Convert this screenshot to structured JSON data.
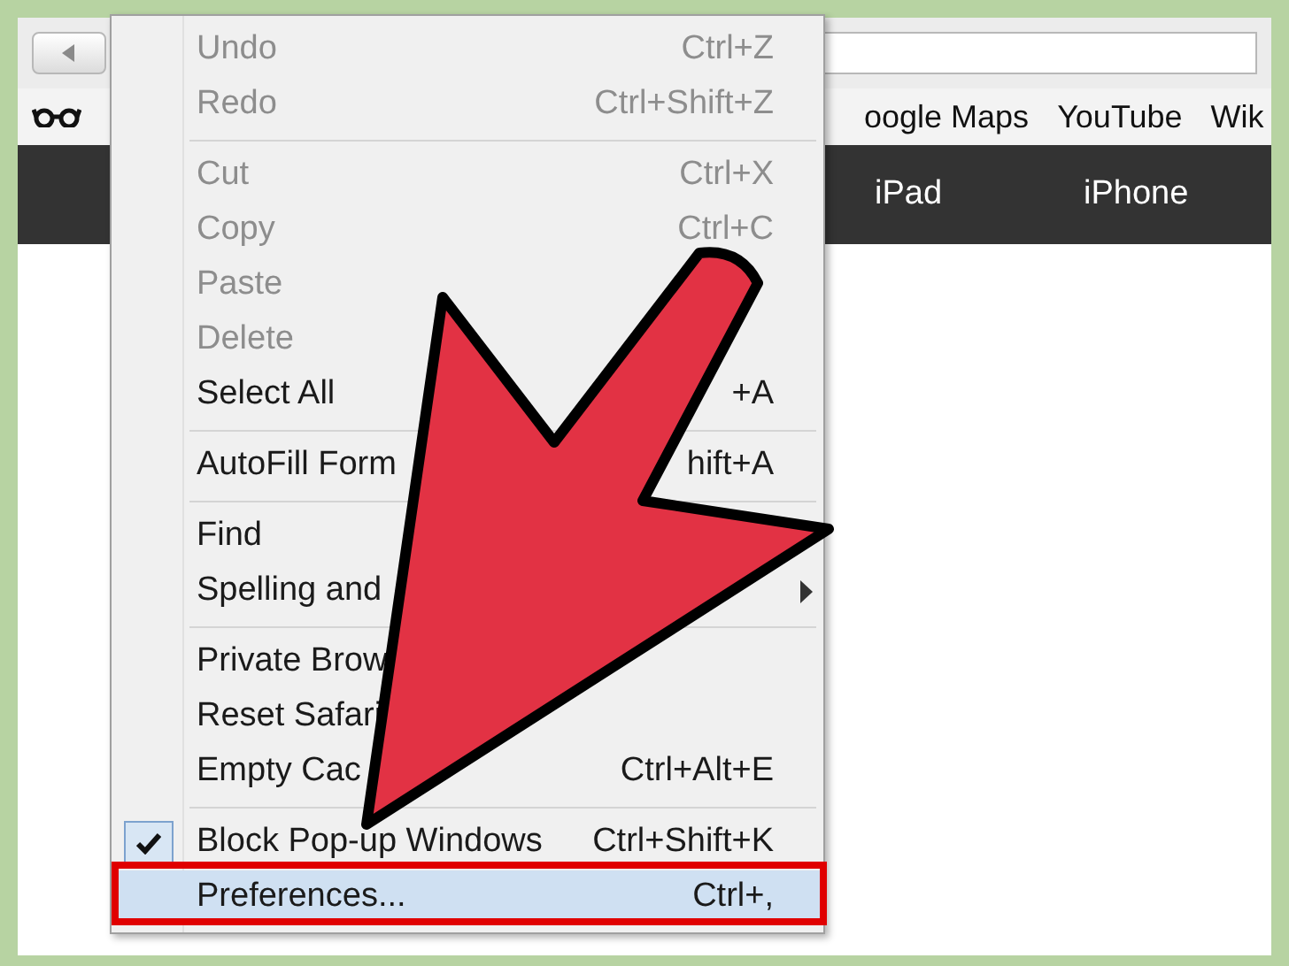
{
  "bookmarks_bar": {
    "items": [
      "oogle Maps",
      "YouTube",
      "Wik"
    ]
  },
  "nav_bar": {
    "items": [
      "iPad",
      "iPhone"
    ]
  },
  "menu": {
    "groups": [
      [
        {
          "label": "Undo",
          "shortcut": "Ctrl+Z",
          "disabled": true,
          "checked": false,
          "selected": false,
          "submenu": false
        },
        {
          "label": "Redo",
          "shortcut": "Ctrl+Shift+Z",
          "disabled": true,
          "checked": false,
          "selected": false,
          "submenu": false
        }
      ],
      [
        {
          "label": "Cut",
          "shortcut": "Ctrl+X",
          "disabled": true,
          "checked": false,
          "selected": false,
          "submenu": false
        },
        {
          "label": "Copy",
          "shortcut": "Ctrl+C",
          "disabled": true,
          "checked": false,
          "selected": false,
          "submenu": false
        },
        {
          "label": "Paste",
          "disabled": true,
          "checked": false,
          "selected": false,
          "submenu": false
        },
        {
          "label": "Delete",
          "disabled": true,
          "checked": false,
          "selected": false,
          "submenu": false
        },
        {
          "label": "Select All",
          "shortcut": "+A",
          "disabled": false,
          "checked": false,
          "selected": false,
          "submenu": false
        }
      ],
      [
        {
          "label": "AutoFill Form",
          "shortcut": "hift+A",
          "disabled": false,
          "checked": false,
          "selected": false,
          "submenu": false
        }
      ],
      [
        {
          "label": "Find",
          "disabled": false,
          "checked": false,
          "selected": false
        },
        {
          "label": "Spelling and",
          "disabled": false,
          "checked": false,
          "selected": false,
          "submenu": true
        }
      ],
      [
        {
          "label": "Private Brow",
          "disabled": false,
          "checked": false,
          "selected": false,
          "submenu": false
        },
        {
          "label": "Reset Safari",
          "disabled": false,
          "checked": false,
          "selected": false,
          "submenu": false
        },
        {
          "label": "Empty Cac",
          "shortcut": "Ctrl+Alt+E",
          "disabled": false,
          "checked": false,
          "selected": false,
          "submenu": false
        }
      ],
      [
        {
          "label": "Block Pop-up Windows",
          "shortcut": "Ctrl+Shift+K",
          "disabled": false,
          "checked": true,
          "selected": false,
          "submenu": false
        },
        {
          "label": "Preferences...",
          "shortcut": "Ctrl+,",
          "disabled": false,
          "checked": false,
          "selected": true,
          "submenu": false
        }
      ]
    ]
  }
}
